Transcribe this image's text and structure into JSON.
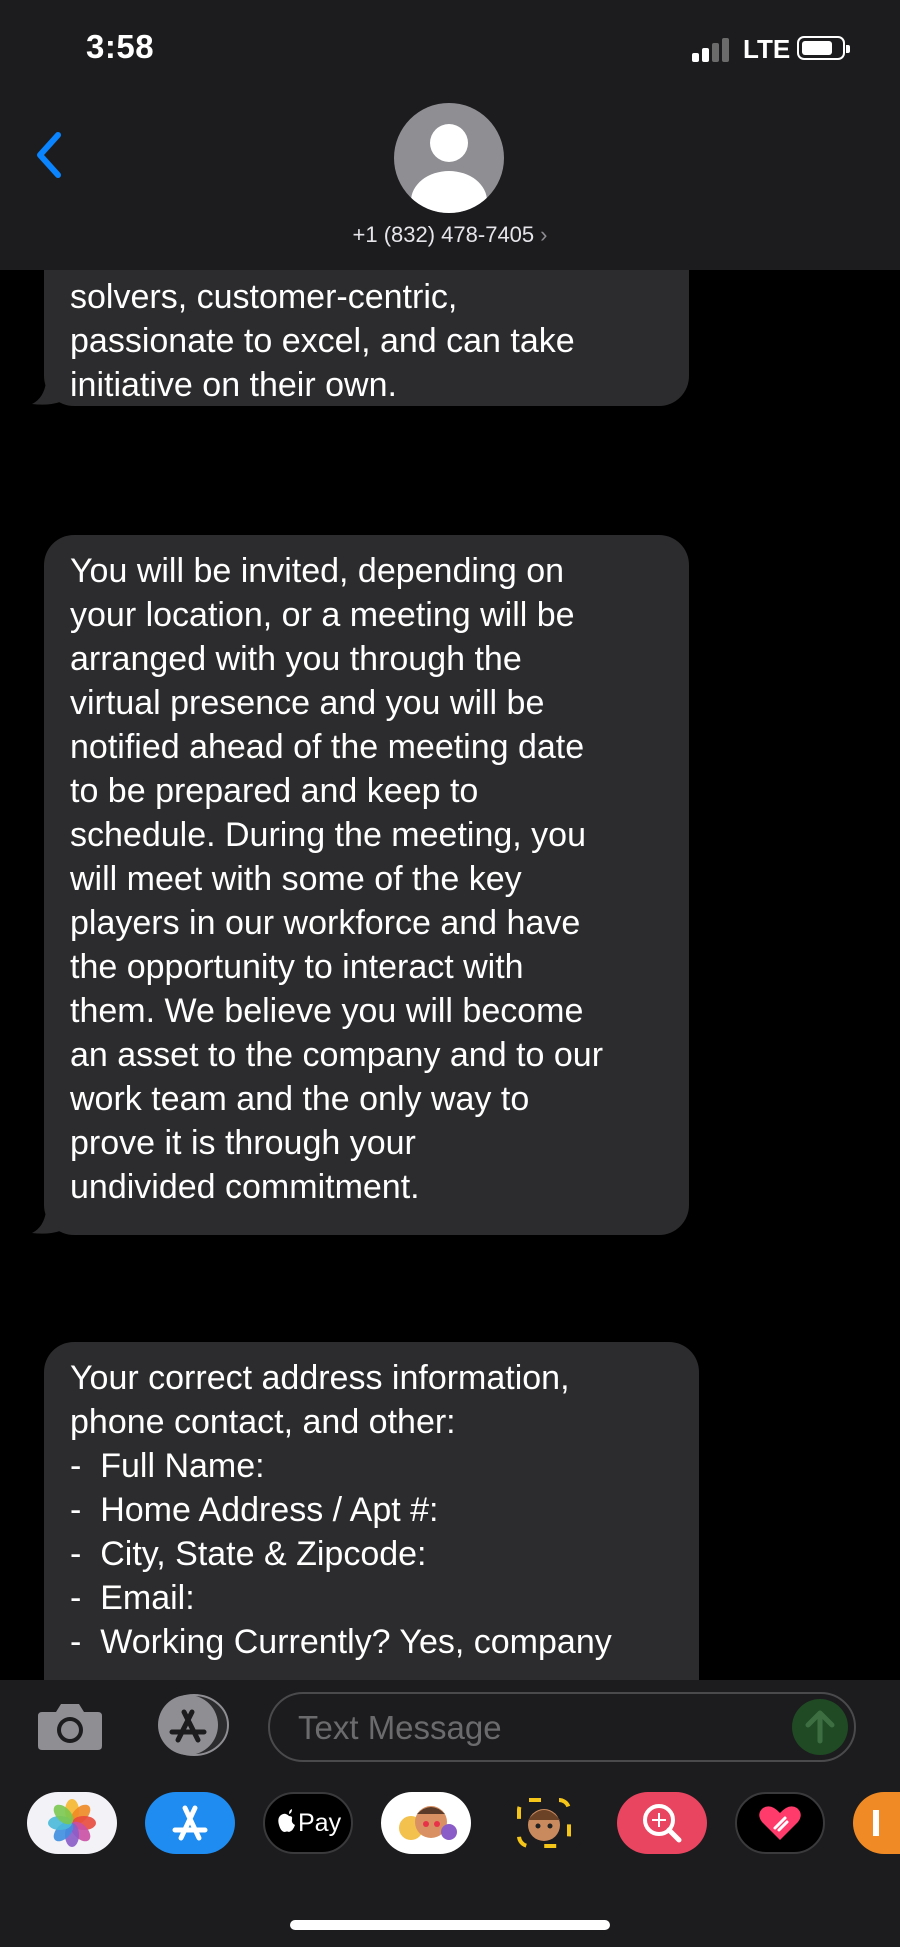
{
  "status": {
    "time": "3:58",
    "network": "LTE",
    "signal_bars": 2,
    "signal_bars_max": 4
  },
  "header": {
    "back_icon": "chevron-left-icon",
    "avatar_icon": "person-silhouette-icon",
    "contact": "+1 (832) 478-7405",
    "contact_chevron": "›"
  },
  "messages": [
    {
      "lines": [
        "solvers, customer-centric,",
        "passionate to excel, and can take",
        "initiative on their own."
      ]
    },
    {
      "lines": [
        "You will be invited, depending on",
        "your location, or a meeting will be",
        "arranged with you through the",
        "virtual presence and you will be",
        "notified ahead of the meeting date",
        "to be prepared and keep to",
        "schedule. During the meeting, you",
        "will meet with some of the key",
        "players in our workforce and have",
        "the opportunity to interact with",
        "them. We believe you will become",
        "an asset to the company and to our",
        "work team and the only way to",
        "prove it is through your",
        "undivided commitment."
      ]
    },
    {
      "lines": [
        "Your correct address information,",
        "phone contact, and other:",
        "-  Full Name:",
        "-  Home Address / Apt #:",
        "-  City, State & Zipcode:",
        "-  Email:",
        "-  Working Currently? Yes, company"
      ]
    }
  ],
  "composer": {
    "camera_icon": "camera-icon",
    "apps_icon": "app-store-icon",
    "placeholder": "Text Message",
    "send_icon": "arrow-up-icon"
  },
  "app_tray": [
    {
      "name": "photos-app-icon"
    },
    {
      "name": "app-store-app-icon"
    },
    {
      "name": "apple-pay-app-icon",
      "label": "Pay"
    },
    {
      "name": "memoji-stickers-app-icon"
    },
    {
      "name": "memoji-app-icon"
    },
    {
      "name": "image-search-app-icon"
    },
    {
      "name": "digital-touch-app-icon"
    },
    {
      "name": "partial-app-icon"
    }
  ],
  "colors": {
    "bubble": "#2c2c2e",
    "bar": "#1c1c1e",
    "accent": "#0a84ff"
  }
}
